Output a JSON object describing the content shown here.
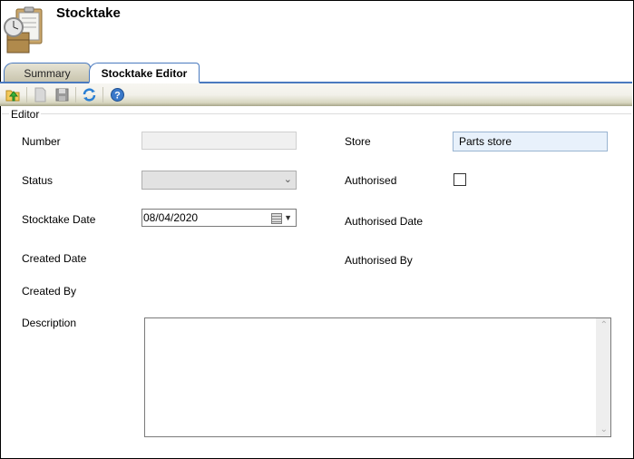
{
  "header": {
    "title": "Stocktake",
    "icon": "stocktake-clipboard-clock-icon"
  },
  "tabs": [
    {
      "label": "Summary",
      "active": false
    },
    {
      "label": "Stocktake Editor",
      "active": true
    }
  ],
  "toolbar": {
    "buttons": [
      {
        "name": "open-folder-icon",
        "enabled": true
      },
      {
        "name": "new-document-icon",
        "enabled": false
      },
      {
        "name": "save-icon",
        "enabled": false
      },
      {
        "name": "refresh-icon",
        "enabled": true
      },
      {
        "name": "help-icon",
        "enabled": true
      }
    ]
  },
  "editor": {
    "group_label": "Editor",
    "labels": {
      "number": "Number",
      "status": "Status",
      "stocktake_date": "Stocktake Date",
      "created_date": "Created Date",
      "created_by": "Created By",
      "description": "Description",
      "store": "Store",
      "authorised": "Authorised",
      "authorised_date": "Authorised Date",
      "authorised_by": "Authorised By"
    },
    "values": {
      "number": "",
      "status": "",
      "stocktake_date": "08/04/2020",
      "store": "Parts store",
      "authorised": false,
      "description": ""
    }
  }
}
